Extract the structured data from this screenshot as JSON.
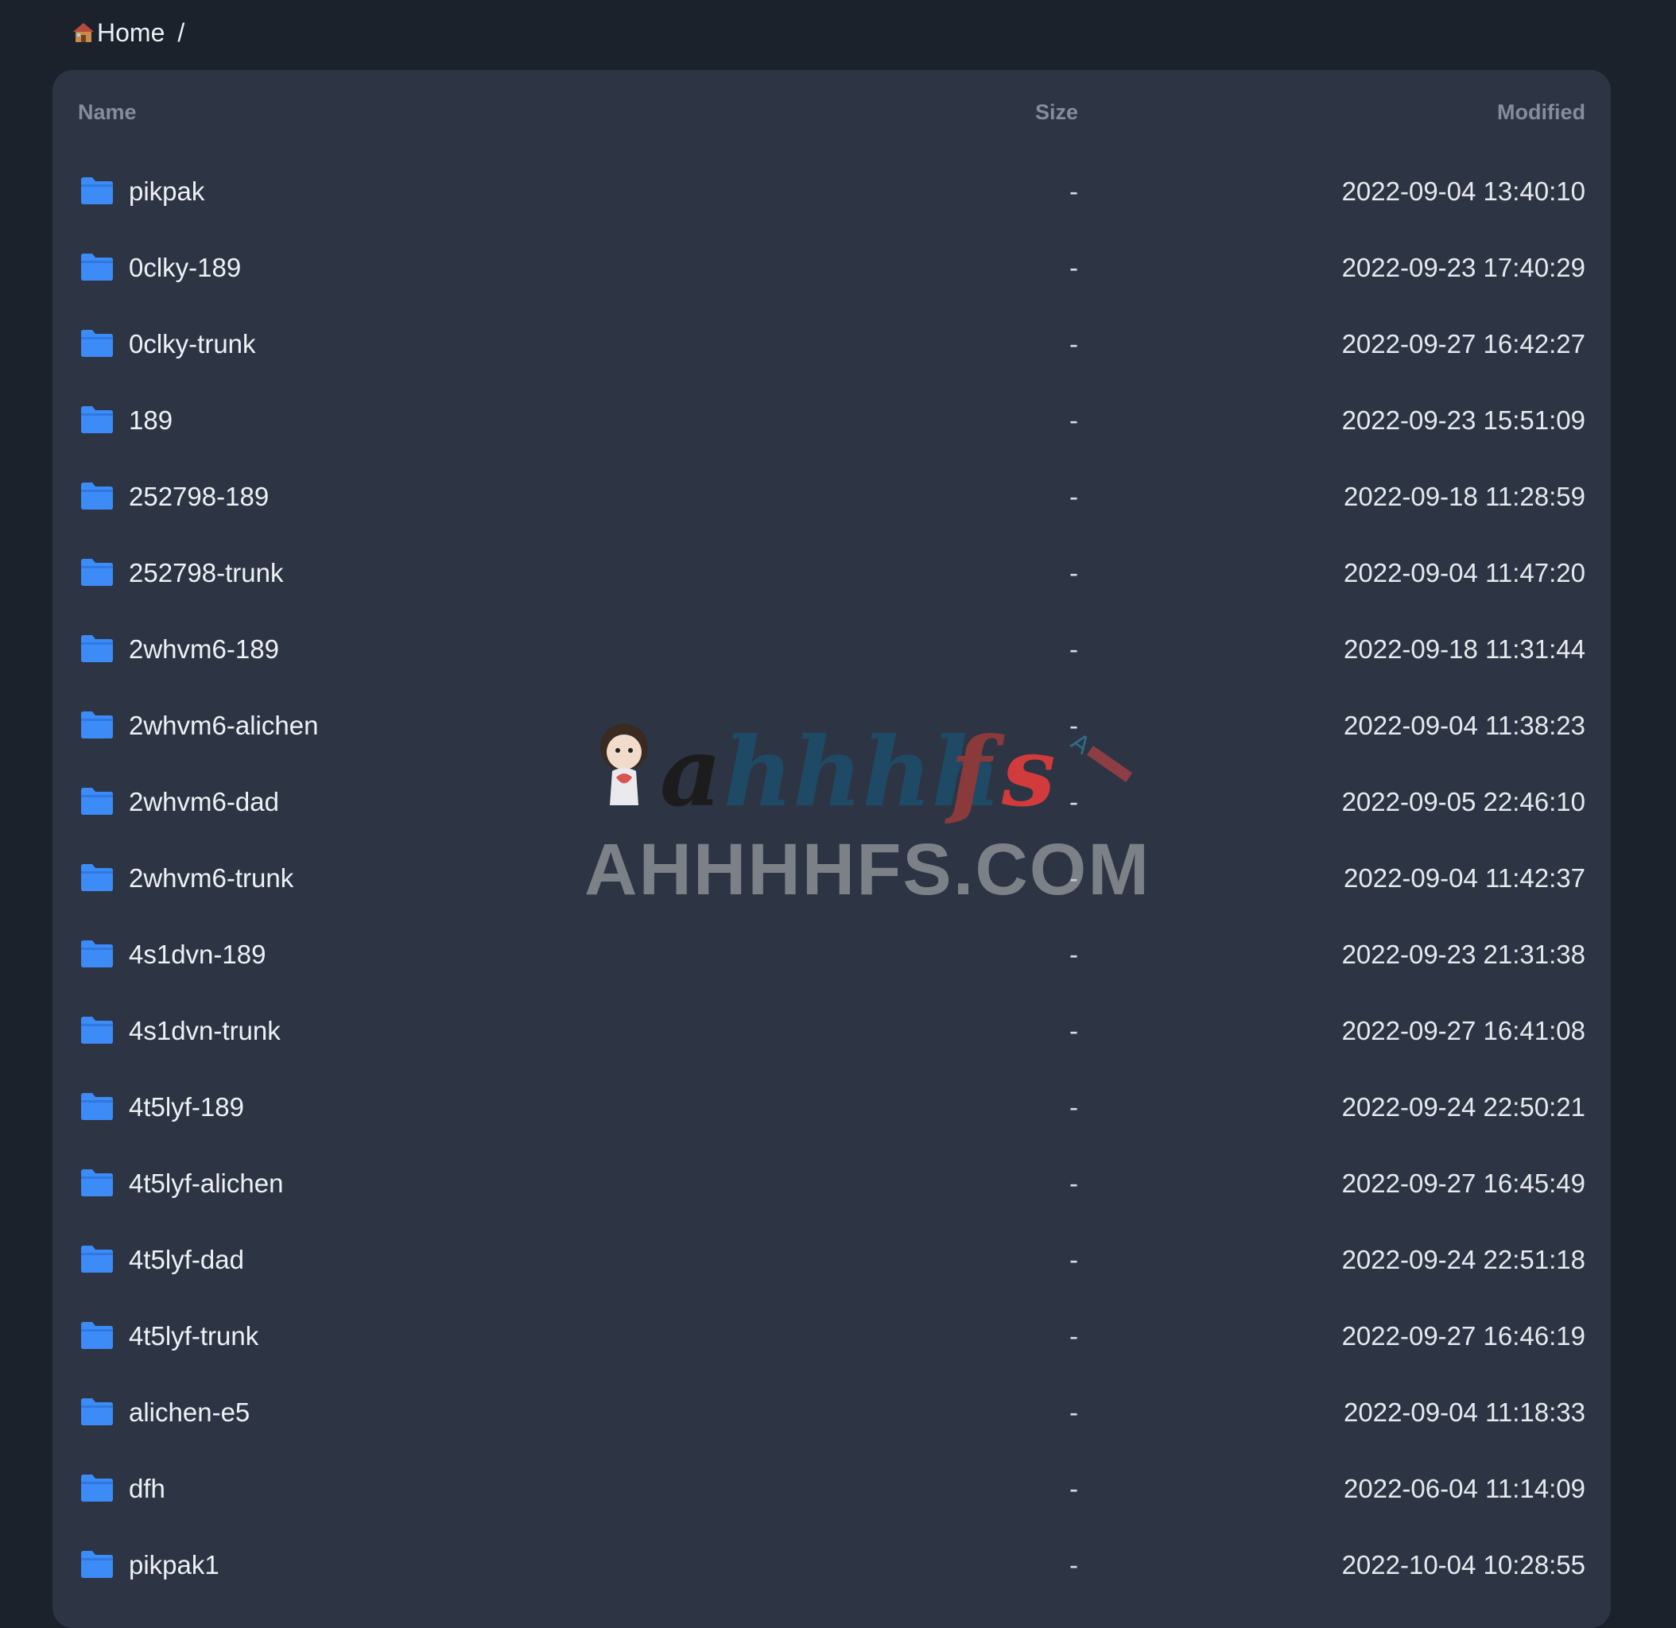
{
  "breadcrumb": {
    "home_label": "Home",
    "separator": "/"
  },
  "table": {
    "columns": {
      "name": "Name",
      "size": "Size",
      "modified": "Modified"
    },
    "rows": [
      {
        "name": "pikpak",
        "size": "-",
        "modified": "2022-09-04 13:40:10"
      },
      {
        "name": "0clky-189",
        "size": "-",
        "modified": "2022-09-23 17:40:29"
      },
      {
        "name": "0clky-trunk",
        "size": "-",
        "modified": "2022-09-27 16:42:27"
      },
      {
        "name": "189",
        "size": "-",
        "modified": "2022-09-23 15:51:09"
      },
      {
        "name": "252798-189",
        "size": "-",
        "modified": "2022-09-18 11:28:59"
      },
      {
        "name": "252798-trunk",
        "size": "-",
        "modified": "2022-09-04 11:47:20"
      },
      {
        "name": "2whvm6-189",
        "size": "-",
        "modified": "2022-09-18 11:31:44"
      },
      {
        "name": "2whvm6-alichen",
        "size": "-",
        "modified": "2022-09-04 11:38:23"
      },
      {
        "name": "2whvm6-dad",
        "size": "-",
        "modified": "2022-09-05 22:46:10"
      },
      {
        "name": "2whvm6-trunk",
        "size": "-",
        "modified": "2022-09-04 11:42:37"
      },
      {
        "name": "4s1dvn-189",
        "size": "-",
        "modified": "2022-09-23 21:31:38"
      },
      {
        "name": "4s1dvn-trunk",
        "size": "-",
        "modified": "2022-09-27 16:41:08"
      },
      {
        "name": "4t5lyf-189",
        "size": "-",
        "modified": "2022-09-24 22:50:21"
      },
      {
        "name": "4t5lyf-alichen",
        "size": "-",
        "modified": "2022-09-27 16:45:49"
      },
      {
        "name": "4t5lyf-dad",
        "size": "-",
        "modified": "2022-09-24 22:51:18"
      },
      {
        "name": "4t5lyf-trunk",
        "size": "-",
        "modified": "2022-09-27 16:46:19"
      },
      {
        "name": "alichen-e5",
        "size": "-",
        "modified": "2022-09-04 11:18:33"
      },
      {
        "name": "dfh",
        "size": "-",
        "modified": "2022-06-04 11:14:09"
      },
      {
        "name": "pikpak1",
        "size": "-",
        "modified": "2022-10-04 10:28:55"
      }
    ]
  },
  "watermark": {
    "logo_text": "ahhhhfs",
    "domain_text": "AHHHHFS.COM"
  },
  "icons": {
    "home": "home-icon",
    "folder": "folder-icon"
  },
  "colors": {
    "page_bg": "#1b222c",
    "panel_bg": "#2d3545",
    "folder_blue": "#3d8bf7",
    "header_text": "#858d9c"
  }
}
